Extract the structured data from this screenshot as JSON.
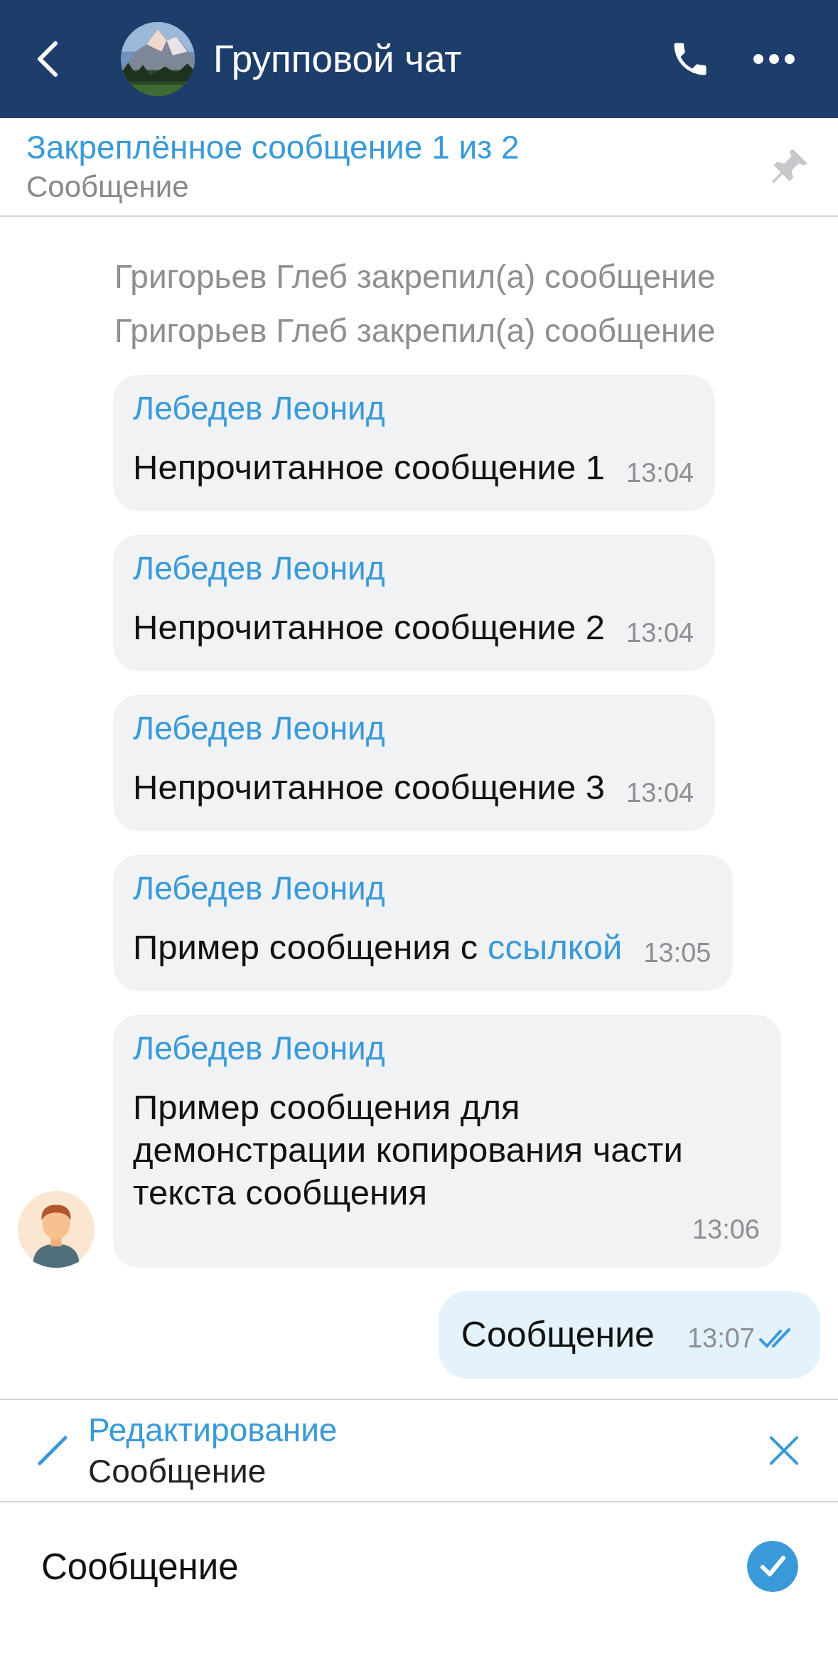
{
  "header": {
    "title": "Групповой чат"
  },
  "pinned": {
    "title": "Закреплённое сообщение 1 из 2",
    "text": "Сообщение"
  },
  "system_messages": [
    {
      "text": "Григорьев Глеб закрепил(а) сообщение"
    },
    {
      "text": "Григорьев Глеб закрепил(а) сообщение"
    }
  ],
  "messages": [
    {
      "sender": "Лебедев Леонид",
      "text": "Непрочитанное сообщение 1",
      "time": "13:04",
      "show_avatar": false
    },
    {
      "sender": "Лебедев Леонид",
      "text": "Непрочитанное сообщение 2",
      "time": "13:04",
      "show_avatar": false
    },
    {
      "sender": "Лебедев Леонид",
      "text": "Непрочитанное сообщение 3",
      "time": "13:04",
      "show_avatar": false
    },
    {
      "sender": "Лебедев Леонид",
      "text": "Пример сообщения с",
      "link": "ссылкой",
      "time": "13:05",
      "show_avatar": false
    },
    {
      "sender": "Лебедев Леонид",
      "text": "Пример сообщения для демонстрации копирования части текста сообщения",
      "time": "13:06",
      "show_avatar": true
    }
  ],
  "outgoing": {
    "text": "Сообщение",
    "time": "13:07",
    "read": true
  },
  "edit_bar": {
    "title": "Редактирование",
    "text": "Сообщение"
  },
  "input": {
    "value": "Сообщение"
  }
}
